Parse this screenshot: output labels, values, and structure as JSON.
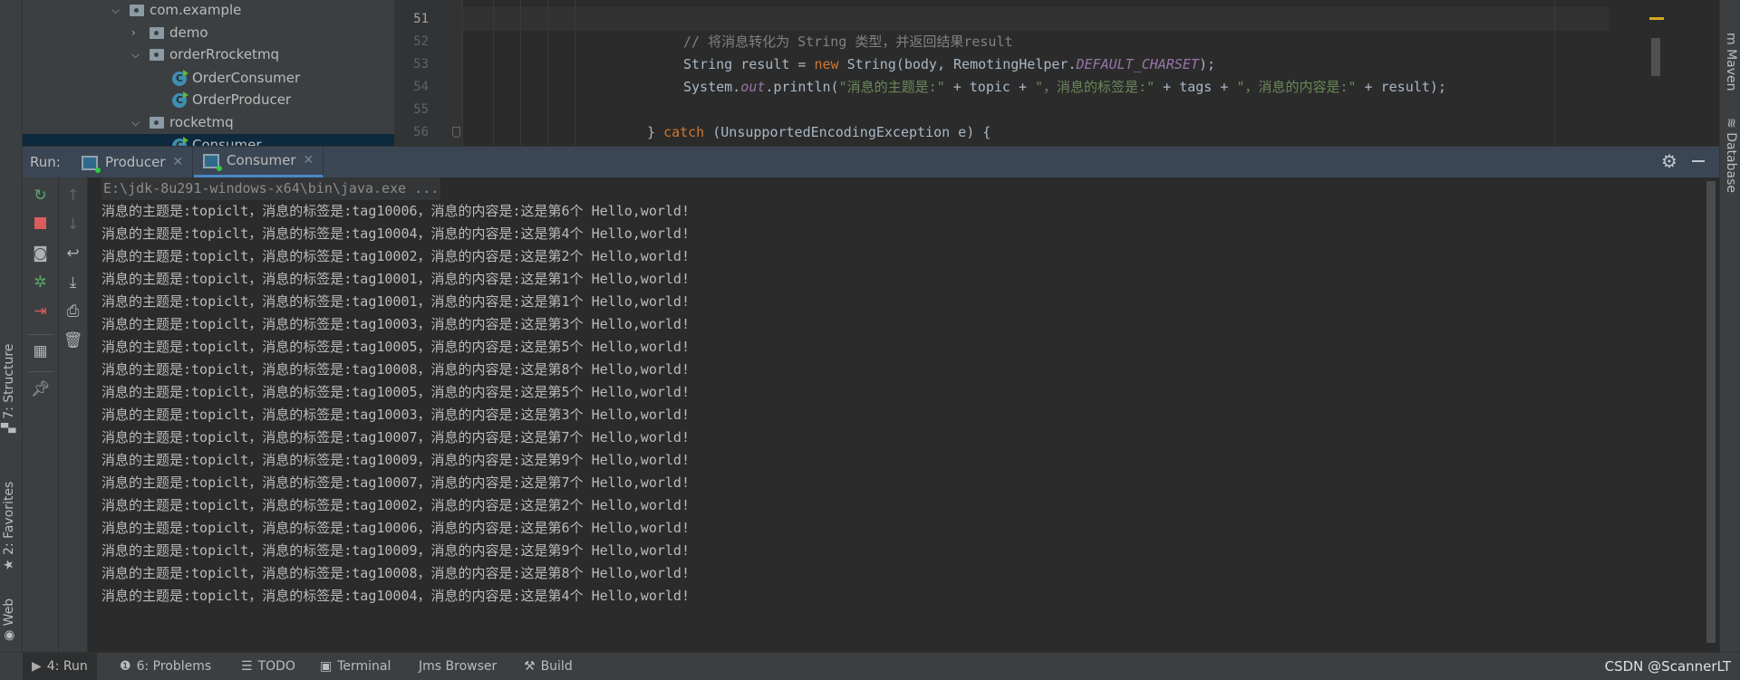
{
  "left_stripe": {
    "tabs": [
      "7: Structure",
      "2: Favorites",
      "Web"
    ]
  },
  "right_stripe": {
    "tabs": [
      "Maven",
      "Database"
    ]
  },
  "project_tree": {
    "items": [
      {
        "label": "com.example",
        "type": "package",
        "expanded": true
      },
      {
        "label": "demo",
        "type": "package",
        "expanded": false
      },
      {
        "label": "orderRrocketmq",
        "type": "package",
        "expanded": true
      },
      {
        "label": "OrderConsumer",
        "type": "class"
      },
      {
        "label": "OrderProducer",
        "type": "class"
      },
      {
        "label": "rocketmq",
        "type": "package",
        "expanded": true
      },
      {
        "label": "Consumer",
        "type": "class",
        "selected": true
      }
    ]
  },
  "editor": {
    "current_line": "51",
    "line_numbers": [
      "51",
      "52",
      "53",
      "54",
      "55",
      "56"
    ],
    "lines": {
      "l52_comment": "// 将消息转化为 String 类型，并返回结果result",
      "l53_a": "String result = ",
      "l53_kw": "new",
      "l53_b": " String(body, RemotingHelper.",
      "l53_const": "DEFAULT_CHARSET",
      "l53_c": ");",
      "l54_a": "System.",
      "l54_out": "out",
      "l54_b": ".println(",
      "l54_s1": "\"消息的主题是:\"",
      "l54_c": " + topic + ",
      "l54_s2": "\"，消息的标签是:\"",
      "l54_d": " + tags + ",
      "l54_s3": "\"，消息的内容是:\"",
      "l54_e": " + result);",
      "l56_a": "} ",
      "l56_kw": "catch",
      "l56_b": " (UnsupportedEncodingException e) {"
    }
  },
  "run_panel": {
    "label": "Run:",
    "tabs": [
      {
        "label": "Producer",
        "active": false
      },
      {
        "label": "Consumer",
        "active": true
      }
    ],
    "toolbar_left": [
      "rerun-icon",
      "stop-icon",
      "snapshot-icon",
      "debug-attach-icon",
      "exit-icon",
      "layout-icon",
      "pin-icon"
    ],
    "toolbar_right": [
      "up-arrow-icon",
      "down-arrow-icon",
      "soft-wrap-icon",
      "scroll-to-end-icon",
      "print-icon",
      "trash-icon"
    ]
  },
  "console": {
    "command": "E:\\jdk-8u291-windows-x64\\bin\\java.exe ...",
    "lines": [
      "消息的主题是:topiclt，消息的标签是:tag10006，消息的内容是:这是第6个 Hello,world!",
      "消息的主题是:topiclt，消息的标签是:tag10004，消息的内容是:这是第4个 Hello,world!",
      "消息的主题是:topiclt，消息的标签是:tag10002，消息的内容是:这是第2个 Hello,world!",
      "消息的主题是:topiclt，消息的标签是:tag10001，消息的内容是:这是第1个 Hello,world!",
      "消息的主题是:topiclt，消息的标签是:tag10001，消息的内容是:这是第1个 Hello,world!",
      "消息的主题是:topiclt，消息的标签是:tag10003，消息的内容是:这是第3个 Hello,world!",
      "消息的主题是:topiclt，消息的标签是:tag10005，消息的内容是:这是第5个 Hello,world!",
      "消息的主题是:topiclt，消息的标签是:tag10008，消息的内容是:这是第8个 Hello,world!",
      "消息的主题是:topiclt，消息的标签是:tag10005，消息的内容是:这是第5个 Hello,world!",
      "消息的主题是:topiclt，消息的标签是:tag10003，消息的内容是:这是第3个 Hello,world!",
      "消息的主题是:topiclt，消息的标签是:tag10007，消息的内容是:这是第7个 Hello,world!",
      "消息的主题是:topiclt，消息的标签是:tag10009，消息的内容是:这是第9个 Hello,world!",
      "消息的主题是:topiclt，消息的标签是:tag10007，消息的内容是:这是第7个 Hello,world!",
      "消息的主题是:topiclt，消息的标签是:tag10002，消息的内容是:这是第2个 Hello,world!",
      "消息的主题是:topiclt，消息的标签是:tag10006，消息的内容是:这是第6个 Hello,world!",
      "消息的主题是:topiclt，消息的标签是:tag10009，消息的内容是:这是第9个 Hello,world!",
      "消息的主题是:topiclt，消息的标签是:tag10008，消息的内容是:这是第8个 Hello,world!",
      "消息的主题是:topiclt，消息的标签是:tag10004，消息的内容是:这是第4个 Hello,world!"
    ]
  },
  "status_bar": {
    "tabs": [
      {
        "label": "4: Run",
        "icon": "run-icon",
        "active": true
      },
      {
        "label": "6: Problems",
        "icon": "problems-icon"
      },
      {
        "label": "TODO",
        "icon": "list-icon"
      },
      {
        "label": "Terminal",
        "icon": "terminal-icon"
      },
      {
        "label": "Jms Browser",
        "icon": ""
      },
      {
        "label": "Build",
        "icon": "hammer-icon"
      }
    ],
    "watermark": "CSDN @ScannerLT"
  },
  "colors": {
    "accent": "#4a88c7",
    "selection": "#0d293e",
    "keyword": "#cc7832",
    "string": "#6a8759",
    "constant": "#9876aa"
  }
}
